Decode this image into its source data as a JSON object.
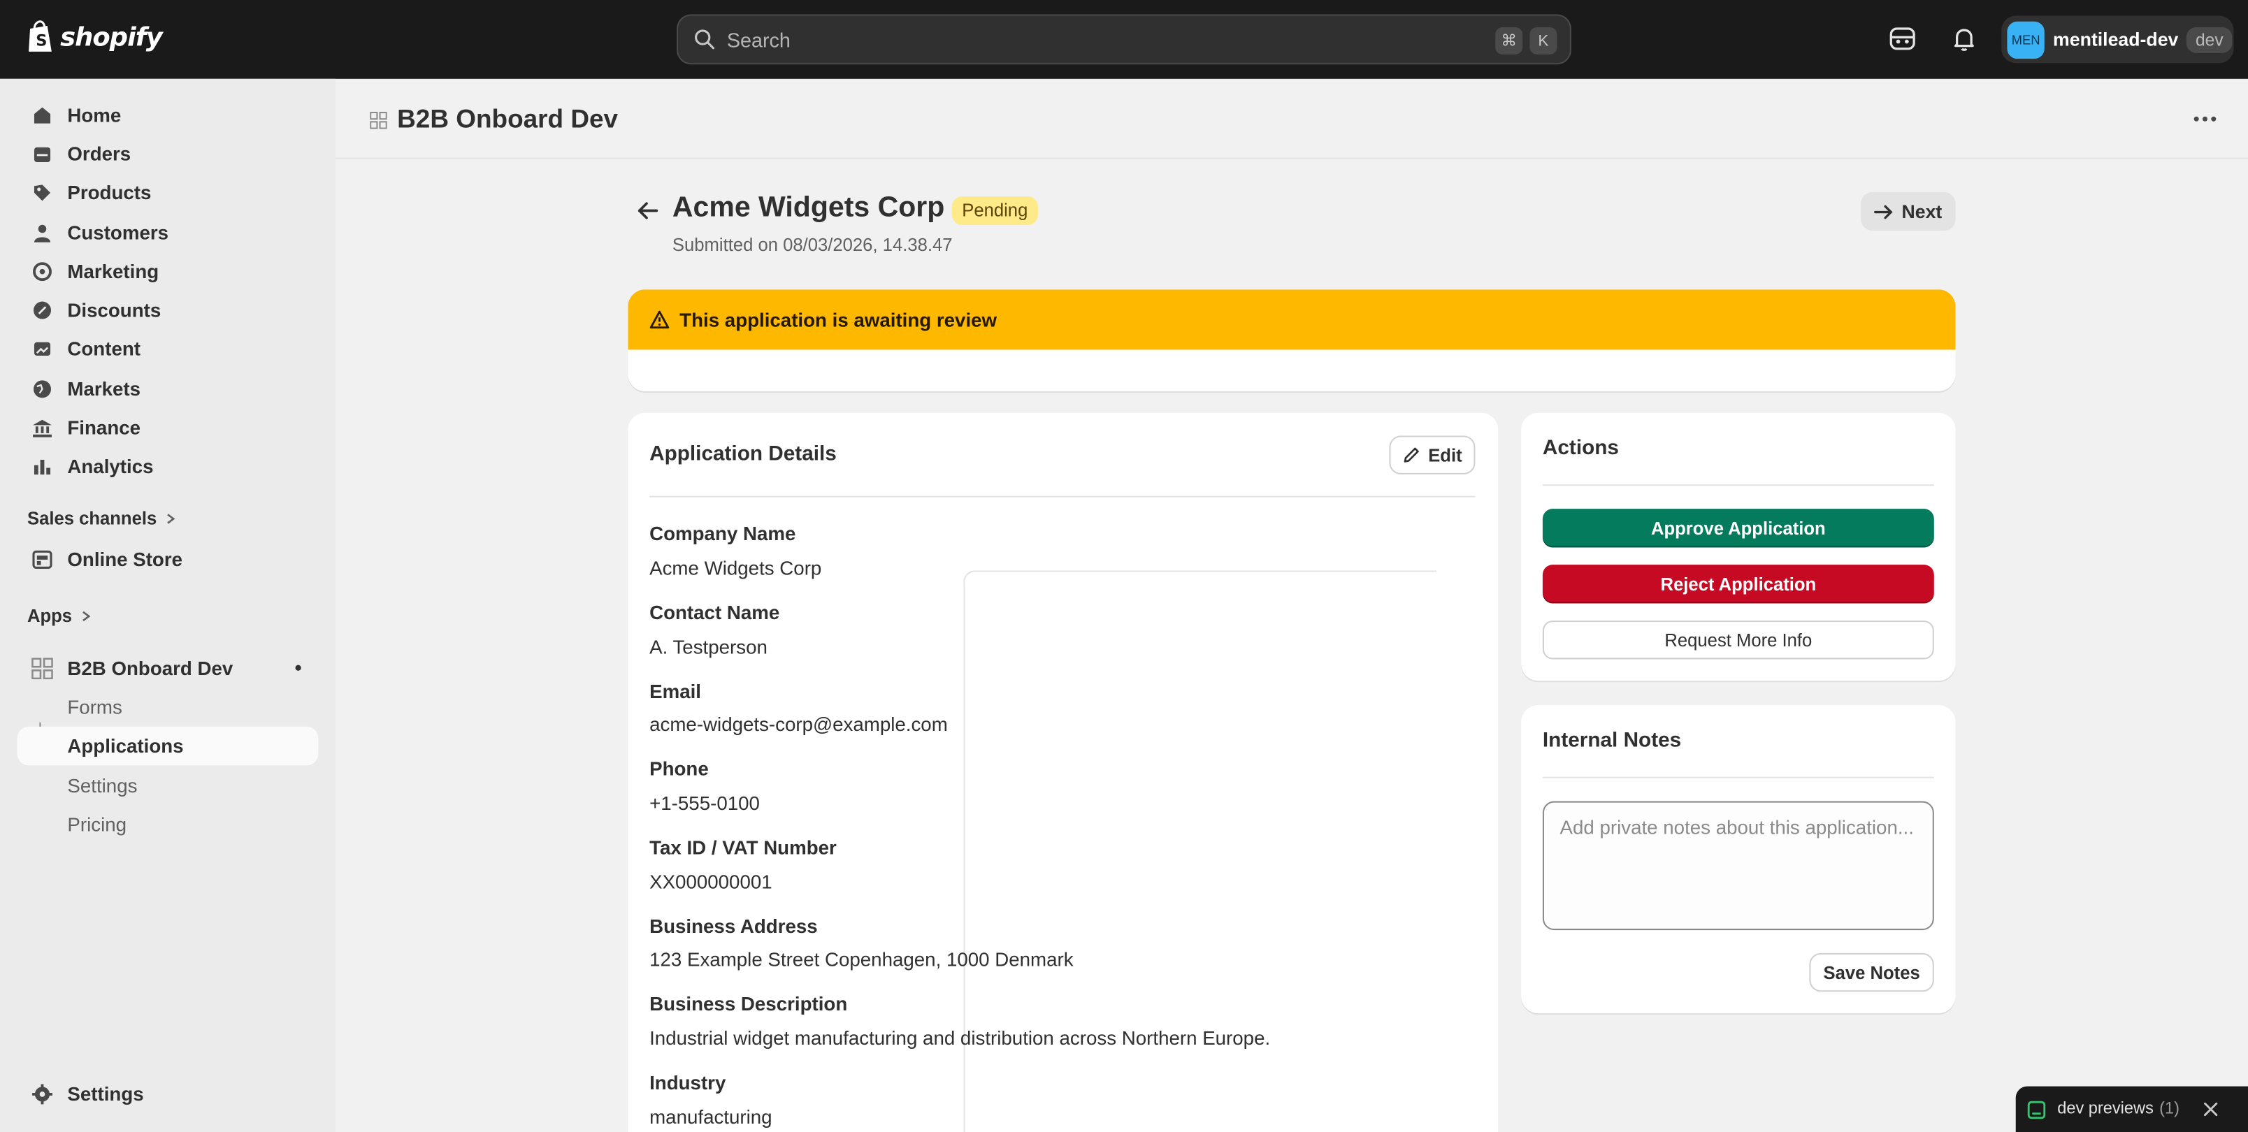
{
  "topbar": {
    "logo_text": "shopify",
    "search_placeholder": "Search",
    "shortcut_cmd": "⌘",
    "shortcut_key": "K",
    "account_initials": "MEN",
    "account_name": "mentilead-dev",
    "account_badge": "dev"
  },
  "sidebar": {
    "items": [
      {
        "label": "Home",
        "icon": "home-icon"
      },
      {
        "label": "Orders",
        "icon": "orders-icon"
      },
      {
        "label": "Products",
        "icon": "tag-icon"
      },
      {
        "label": "Customers",
        "icon": "person-icon"
      },
      {
        "label": "Marketing",
        "icon": "target-icon"
      },
      {
        "label": "Discounts",
        "icon": "discount-icon"
      },
      {
        "label": "Content",
        "icon": "image-icon"
      },
      {
        "label": "Markets",
        "icon": "globe-icon"
      },
      {
        "label": "Finance",
        "icon": "bank-icon"
      },
      {
        "label": "Analytics",
        "icon": "bar-chart-icon"
      }
    ],
    "sales_channels_label": "Sales channels",
    "online_store_label": "Online Store",
    "apps_label": "Apps",
    "app_name": "B2B Onboard Dev",
    "app_sub_items": [
      "Forms",
      "Applications",
      "Settings",
      "Pricing"
    ],
    "settings_label": "Settings"
  },
  "header": {
    "app_title": "B2B Onboard Dev"
  },
  "page": {
    "title": "Acme Widgets Corp",
    "status": "Pending",
    "subtitle": "Submitted on 08/03/2026, 14.38.47",
    "next_label": "Next"
  },
  "banner": {
    "text": "This application is awaiting review"
  },
  "details": {
    "title": "Application Details",
    "edit_label": "Edit",
    "fields": [
      {
        "label": "Company Name",
        "value": "Acme Widgets Corp"
      },
      {
        "label": "Contact Name",
        "value": "A. Testperson"
      },
      {
        "label": "Email",
        "value": "acme-widgets-corp@example.com"
      },
      {
        "label": "Phone",
        "value": "+1-555-0100"
      },
      {
        "label": "Tax ID / VAT Number",
        "value": "XX000000001"
      },
      {
        "label": "Business Address",
        "value": "123 Example Street Copenhagen, 1000 Denmark"
      },
      {
        "label": "Business Description",
        "value": "Industrial widget manufacturing and distribution across Northern Europe."
      },
      {
        "label": "Industry",
        "value": "manufacturing"
      }
    ]
  },
  "actions": {
    "title": "Actions",
    "approve_label": "Approve Application",
    "reject_label": "Reject Application",
    "info_label": "Request More Info"
  },
  "notes": {
    "title": "Internal Notes",
    "placeholder": "Add private notes about this application...",
    "save_label": "Save Notes"
  },
  "dev_preview": {
    "label": "dev previews",
    "count": "(1)"
  },
  "colors": {
    "approve": "#047b5d",
    "reject": "#c70a24",
    "banner": "#ffb800",
    "pending_badge": "#ffea8a"
  }
}
